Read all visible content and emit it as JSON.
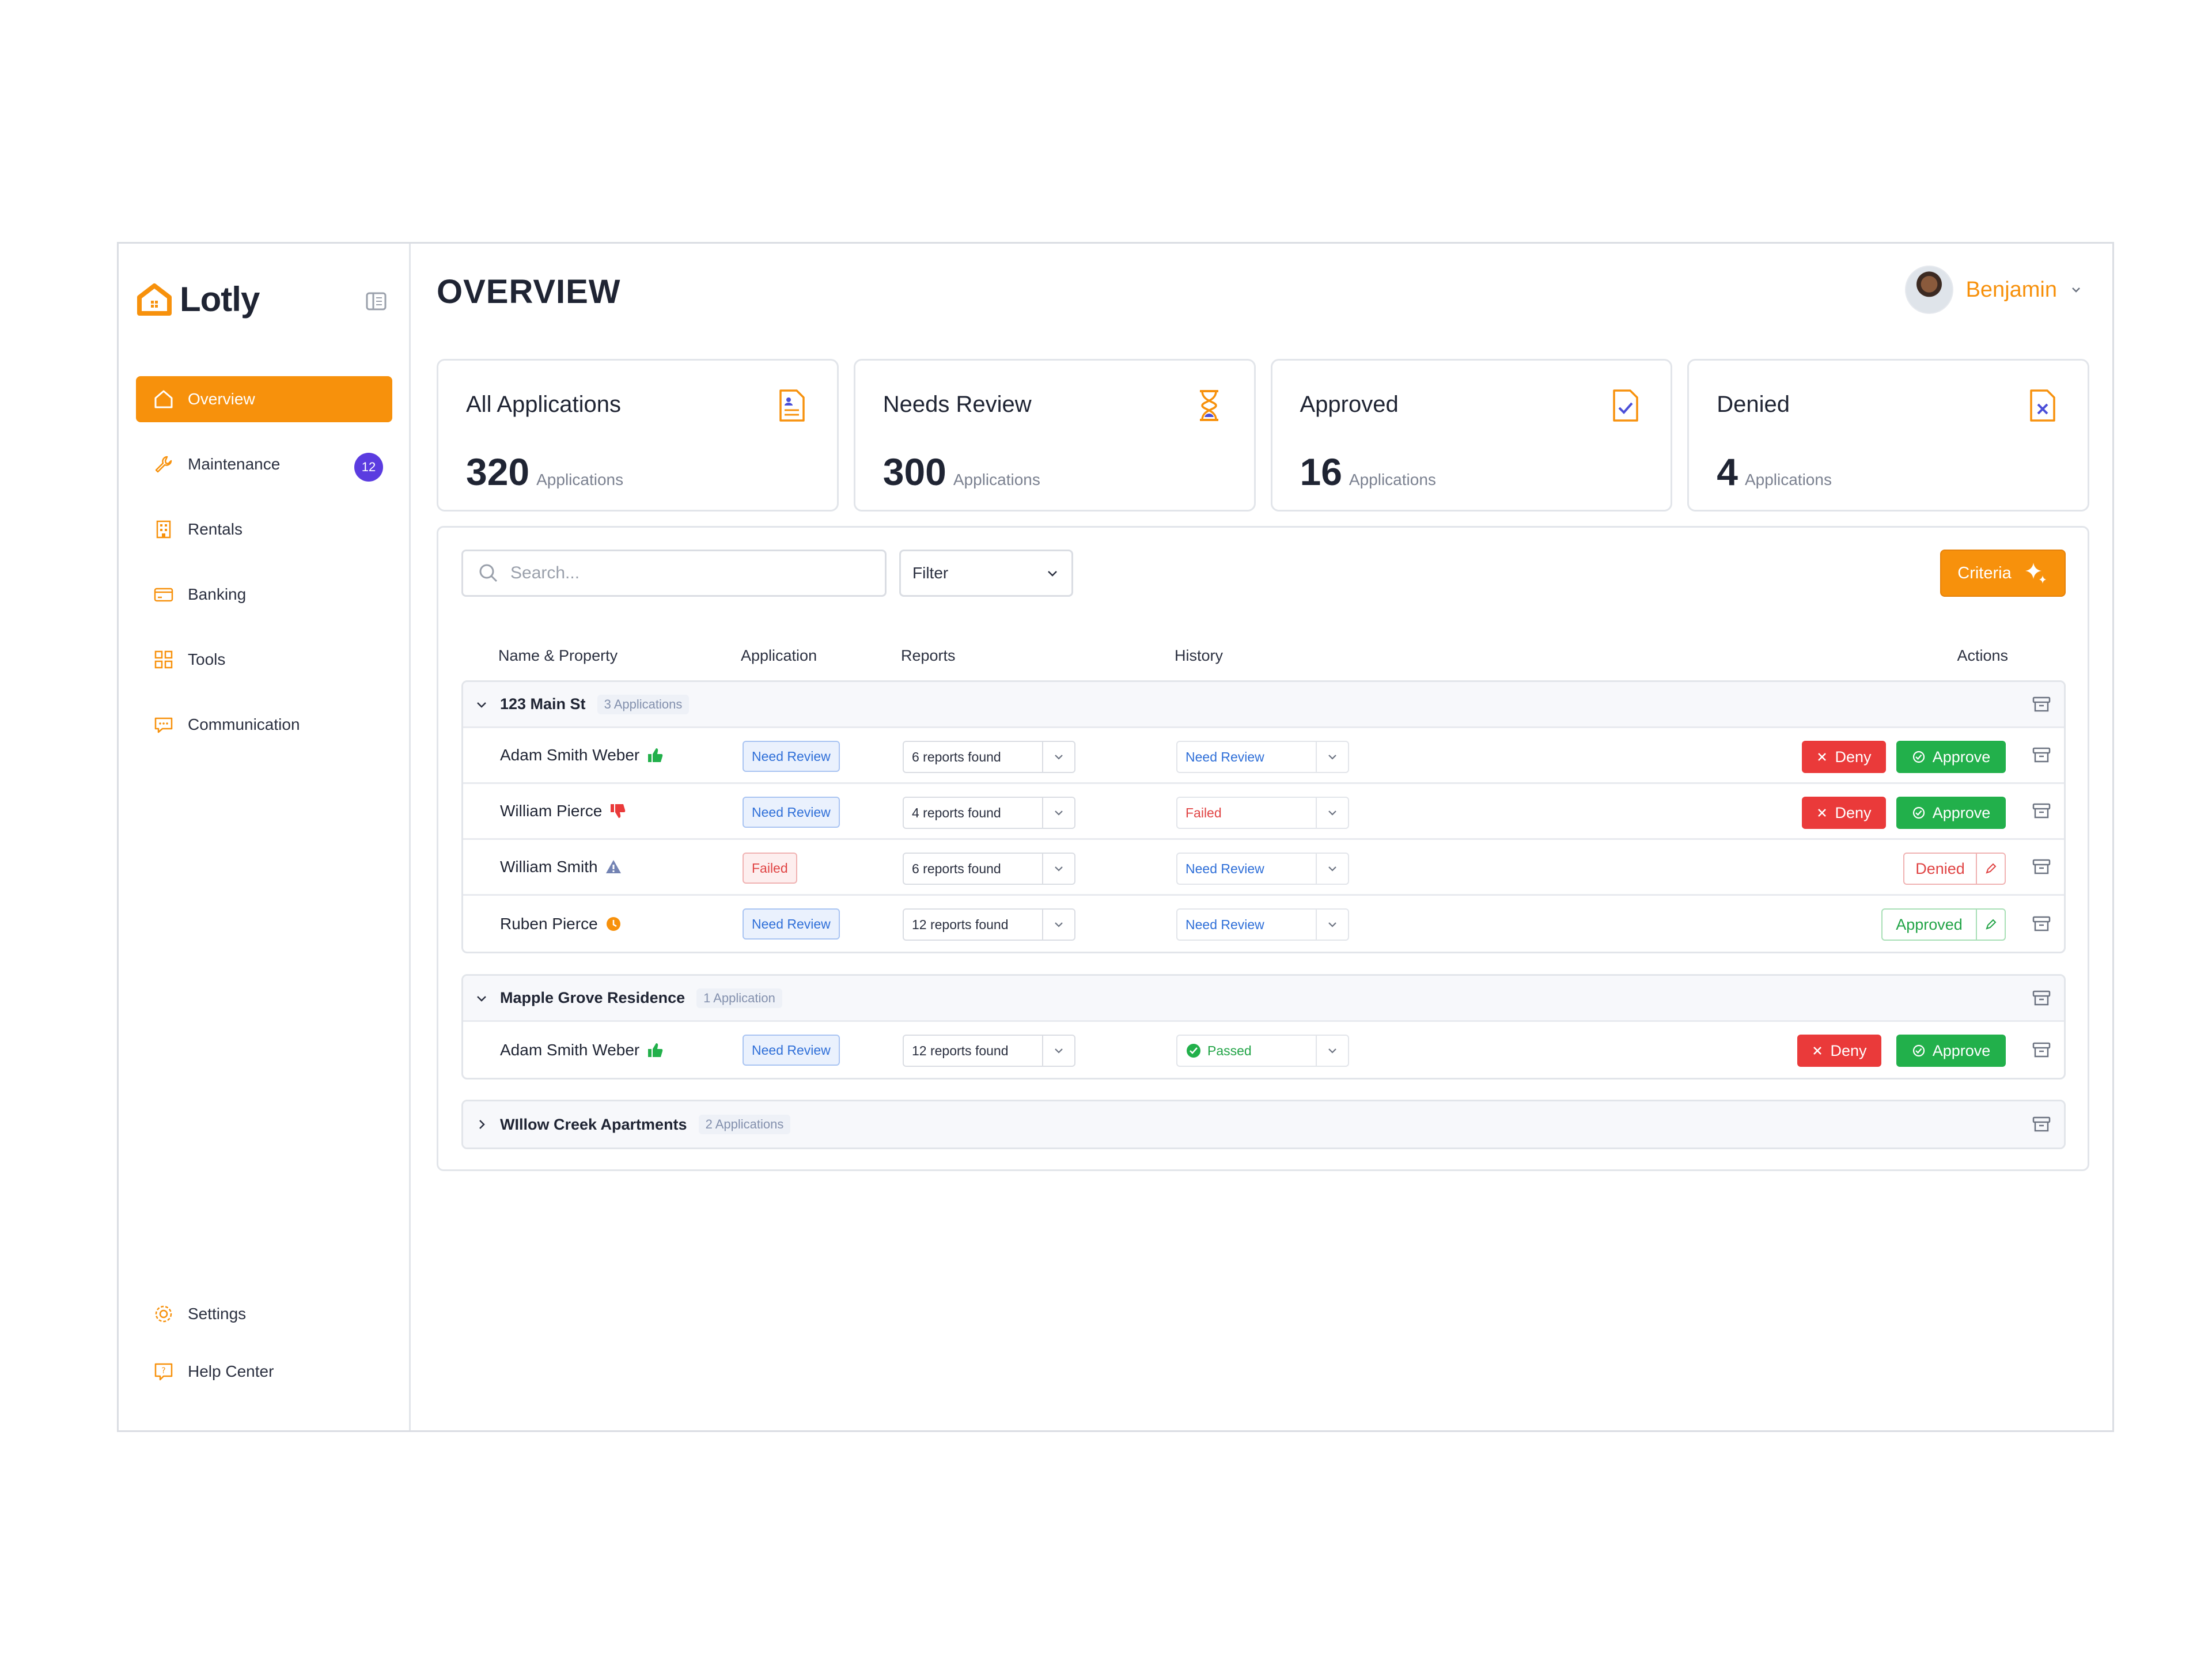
{
  "app": {
    "name": "Lotly"
  },
  "sidebar": {
    "items": [
      {
        "label": "Overview",
        "icon": "home-icon",
        "active": true
      },
      {
        "label": "Maintenance",
        "icon": "wrench-icon",
        "badge": "12"
      },
      {
        "label": "Rentals",
        "icon": "building-icon"
      },
      {
        "label": "Banking",
        "icon": "credit-card-icon"
      },
      {
        "label": "Tools",
        "icon": "grid-icon"
      },
      {
        "label": "Communication",
        "icon": "chat-icon"
      }
    ],
    "bottom": [
      {
        "label": "Settings",
        "icon": "gear-icon"
      },
      {
        "label": "Help Center",
        "icon": "help-icon"
      }
    ]
  },
  "header": {
    "title": "OVERVIEW",
    "user": "Benjamin"
  },
  "stats": [
    {
      "title": "All Applications",
      "value": "320",
      "unit": "Applications",
      "icon": "document-icon",
      "color": "#f7910c"
    },
    {
      "title": "Needs Review",
      "value": "300",
      "unit": "Applications",
      "icon": "hourglass-icon",
      "color": "#f7910c"
    },
    {
      "title": "Approved",
      "value": "16",
      "unit": "Applications",
      "icon": "document-check-icon",
      "color": "#f7910c"
    },
    {
      "title": "Denied",
      "value": "4",
      "unit": "Applications",
      "icon": "document-x-icon",
      "color": "#f7910c"
    }
  ],
  "toolbar": {
    "search_placeholder": "Search...",
    "filter_label": "Filter",
    "criteria_label": "Criteria"
  },
  "table": {
    "columns": [
      "Name & Property",
      "Application",
      "Reports",
      "History",
      "Actions"
    ],
    "groups": [
      {
        "name": "123 Main St",
        "count": "3 Applications",
        "expanded": true,
        "rows": [
          {
            "name": "Adam Smith Weber",
            "indicator": "thumbs-up-icon",
            "application": "Need Review",
            "reports": "6 reports found",
            "history": "Need Review",
            "deny": "Deny",
            "approve": "Approve"
          },
          {
            "name": "William Pierce",
            "indicator": "thumbs-down-icon",
            "application": "Need Review",
            "reports": "4 reports found",
            "history": "Failed",
            "deny": "Deny",
            "approve": "Approve"
          },
          {
            "name": "William Smith",
            "indicator": "warning-icon",
            "application": "Failed",
            "reports": "6 reports found",
            "history": "Need Review",
            "status": "Denied"
          },
          {
            "name": "Ruben Pierce",
            "indicator": "clock-icon",
            "application": "Need Review",
            "reports": "12 reports found",
            "history": "Need Review",
            "status": "Approved"
          }
        ]
      },
      {
        "name": "Mapple Grove Residence",
        "count": "1 Application",
        "expanded": true,
        "rows": [
          {
            "name": "Adam Smith Weber",
            "indicator": "thumbs-up-icon",
            "application": "Need Review",
            "reports": "12 reports found",
            "history": "Passed",
            "deny": "Deny",
            "approve": "Approve"
          }
        ]
      },
      {
        "name": "WIllow Creek Apartments",
        "count": "2 Applications",
        "expanded": false
      }
    ]
  },
  "colors": {
    "accent": "#f7910c",
    "deny": "#ea3a3a",
    "approve": "#22b04b",
    "badge": "#5b3ce0"
  }
}
